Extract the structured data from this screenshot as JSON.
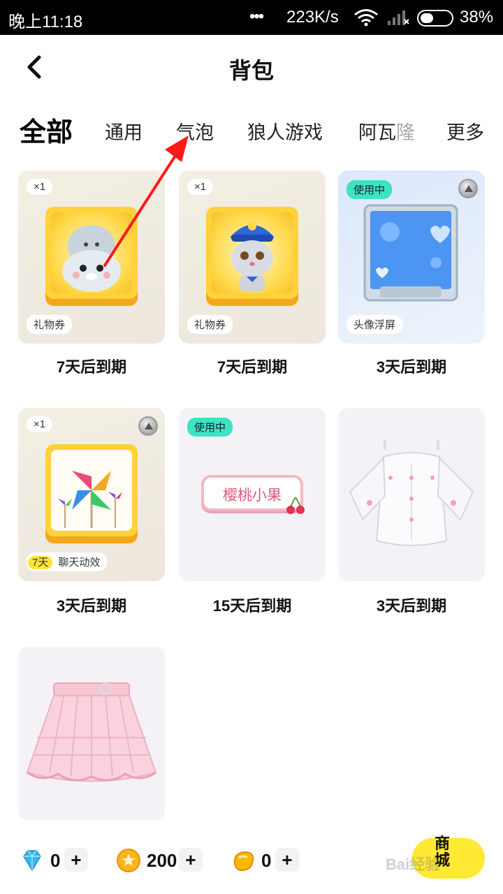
{
  "status_bar": {
    "time": "晚上11:18",
    "dots": "•••",
    "speed": "223K/s",
    "battery": "38%"
  },
  "header": {
    "title": "背包"
  },
  "tabs": [
    {
      "label": "全部",
      "active": true
    },
    {
      "label": "通用"
    },
    {
      "label": "气泡"
    },
    {
      "label": "狼人游戏"
    },
    {
      "label_main": "阿瓦",
      "label_fade": "隆"
    },
    {
      "label": "更多"
    }
  ],
  "items": [
    {
      "qty": "×1",
      "tag": "礼物券",
      "expiry": "7天后到期",
      "icon": "seal-gift-icon"
    },
    {
      "qty": "×1",
      "tag": "礼物券",
      "expiry": "7天后到期",
      "icon": "bunny-police-gift-icon"
    },
    {
      "in_use": "使用中",
      "tag": "头像浮屏",
      "expiry": "3天后到期",
      "icon": "balloon-frame-icon"
    },
    {
      "qty": "×1",
      "tag_days": "7天",
      "tag": "聊天动效",
      "expiry": "3天后到期",
      "icon": "pinwheel-icon"
    },
    {
      "in_use": "使用中",
      "bubble_text": "樱桃小果",
      "expiry": "15天后到期",
      "icon": "cherry-bubble-icon"
    },
    {
      "expiry": "3天后到期",
      "icon": "white-blouse-icon"
    },
    {
      "icon": "pink-skirt-icon"
    }
  ],
  "currency": {
    "diamond": "0",
    "coin": "200",
    "bean": "0",
    "plus": "+"
  },
  "shop_button": {
    "label": "商城"
  },
  "watermark": "Bai经验"
}
